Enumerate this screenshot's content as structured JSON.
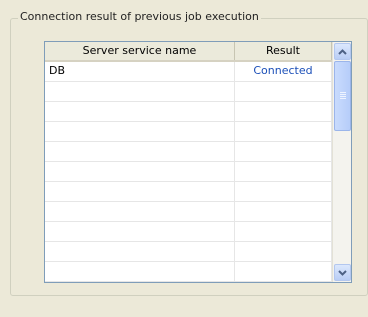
{
  "group": {
    "title": "Connection result of previous job execution"
  },
  "table": {
    "columns": [
      "Server service name",
      "Result"
    ],
    "rows": [
      {
        "service": "DB",
        "result": "Connected"
      },
      {
        "service": "",
        "result": ""
      },
      {
        "service": "",
        "result": ""
      },
      {
        "service": "",
        "result": ""
      },
      {
        "service": "",
        "result": ""
      },
      {
        "service": "",
        "result": ""
      },
      {
        "service": "",
        "result": ""
      },
      {
        "service": "",
        "result": ""
      },
      {
        "service": "",
        "result": ""
      },
      {
        "service": "",
        "result": ""
      },
      {
        "service": "",
        "result": ""
      }
    ]
  },
  "colors": {
    "result_text": "#1b4fb8",
    "scrollbar_accent": "#b9cdf5"
  },
  "icons": {
    "scroll_up": "chevron-up-icon",
    "scroll_down": "chevron-down-icon"
  }
}
